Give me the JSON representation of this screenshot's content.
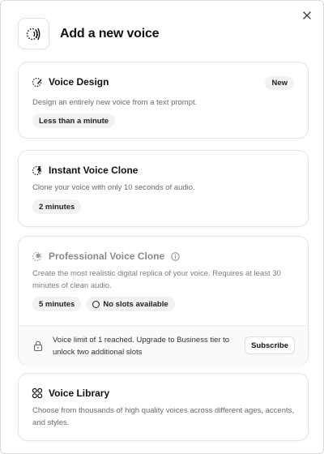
{
  "dialog": {
    "title": "Add a new voice",
    "header_icon": "voice-waves-icon",
    "close_icon": "close-icon"
  },
  "cards": {
    "voice_design": {
      "title": "Voice Design",
      "badge": "New",
      "description": "Design an entirely new voice from a text prompt.",
      "pill": "Less than a minute",
      "icon": "sparkle-pen-icon"
    },
    "instant_clone": {
      "title": "Instant Voice Clone",
      "description": "Clone your voice with only 10 seconds of audio.",
      "pill": "2 minutes",
      "icon": "lightning-icon"
    },
    "professional_clone": {
      "title": "Professional Voice Clone",
      "description": "Create the most realistic digital replica of your voice. Requires at least 30 minutes of clean audio.",
      "pill_time": "5 minutes",
      "pill_slots": "No slots available",
      "info_icon": "info-icon",
      "limit_text": "Voice limit of 1 reached. Upgrade to Business tier to unlock two additional slots",
      "subscribe_label": "Subscribe",
      "lock_icon": "lock-icon"
    },
    "voice_library": {
      "title": "Voice Library",
      "description": "Choose from thousands of high quality voices across different ages, accents, and styles.",
      "icon": "grid-circles-icon"
    }
  }
}
